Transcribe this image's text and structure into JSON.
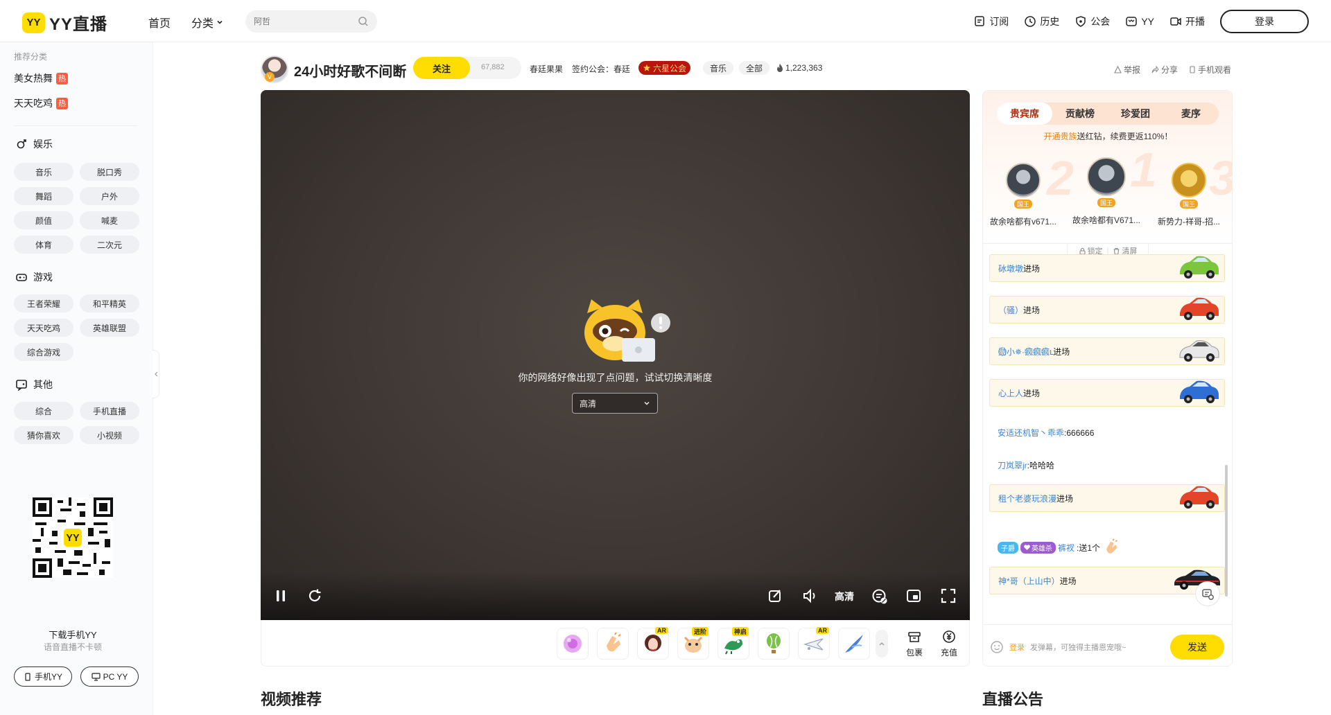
{
  "app": {
    "logo_badge": "YY",
    "logo_text": "YY直播"
  },
  "nav": {
    "home": "首页",
    "category": "分类"
  },
  "search": {
    "placeholder": "阿哲"
  },
  "topright": {
    "subscribe": "订阅",
    "history": "历史",
    "guild": "公会",
    "yy": "YY",
    "broadcast": "开播",
    "login": "登录"
  },
  "sidebar": {
    "rec_head": "推荐分类",
    "recommended": [
      {
        "label": "美女热舞",
        "badge": "热"
      },
      {
        "label": "天天吃鸡",
        "badge": "热"
      }
    ],
    "sections": [
      {
        "title": "娱乐",
        "icon": "female-icon",
        "items": [
          "音乐",
          "脱口秀",
          "舞蹈",
          "户外",
          "颜值",
          "喊麦",
          "体育",
          "二次元"
        ]
      },
      {
        "title": "游戏",
        "icon": "gamepad-icon",
        "items": [
          "王者荣耀",
          "和平精英",
          "天天吃鸡",
          "英雄联盟",
          "综合游戏"
        ]
      },
      {
        "title": "其他",
        "icon": "chat-icon",
        "items": [
          "综合",
          "手机直播",
          "猜你喜欢",
          "小视频"
        ]
      }
    ],
    "download_title": "下载手机YY",
    "download_sub": "语音直播不卡顿",
    "mobile_btn": "手机YY",
    "pc_btn": "PC YY"
  },
  "room": {
    "title": "24小时好歌不间断",
    "follow": "关注",
    "followers": "67,882",
    "anchor": "春廷果果",
    "signed_label": "签约公会：春廷",
    "guild_tag": "六星公会",
    "tag_music": "音乐",
    "tag_all": "全部",
    "heat": "1,223,363",
    "report": "举报",
    "share": "分享",
    "mobile_watch": "手机观看",
    "vip_badge": "V"
  },
  "player": {
    "error_text": "你的网络好像出现了点问题，试试切换清晰度",
    "quality_value": "高清",
    "quality_label": "高清"
  },
  "gifts": {
    "items": [
      {
        "name": "gift-flower",
        "badge": ""
      },
      {
        "name": "gift-clap",
        "badge": ""
      },
      {
        "name": "gift-ar-girl",
        "badge": "AR"
      },
      {
        "name": "gift-pet",
        "badge": "进阶"
      },
      {
        "name": "gift-dragon",
        "badge": "神启"
      },
      {
        "name": "gift-balloon",
        "badge": ""
      },
      {
        "name": "gift-ar-plane",
        "badge": "AR"
      },
      {
        "name": "gift-bird",
        "badge": ""
      }
    ],
    "bag": "包裹",
    "recharge": "充值"
  },
  "rpanel": {
    "tabs": [
      "贵宾席",
      "贡献榜",
      "珍爱团",
      "麦序"
    ],
    "promo_link": "开通贵族",
    "promo_text": "送红钻，续费更返110%！",
    "rank": [
      {
        "name": "故余啥都有v671...",
        "title": "国王",
        "num": "2"
      },
      {
        "name": "故余啥都有V671...",
        "title": "国王",
        "num": "1"
      },
      {
        "name": "新势力-祥哥-招...",
        "title": "国王",
        "num": "3"
      }
    ],
    "lock": "锁定",
    "clear": "清屏",
    "chat": [
      {
        "type": "entry",
        "user": "砅墩墩",
        "text": "进场",
        "car": "#7bc63c"
      },
      {
        "type": "entry",
        "user": "（骚）",
        "text": "进场",
        "car": "#e2452a"
      },
      {
        "type": "entry",
        "user": "勋⃝⃝小✵·疯⃝疯⃝疯⃝ւ",
        "text": "进场",
        "car": "#e8e8e8"
      },
      {
        "type": "entry",
        "user": "心上人",
        "text": "进场",
        "car": "#2f6fd4"
      },
      {
        "type": "msg",
        "user": "安适还机智丶乖乖",
        "text": ":666666"
      },
      {
        "type": "msg",
        "user": "刀岚翠jr",
        "text": ":哈哈哈"
      },
      {
        "type": "entry",
        "user": "租个老婆玩浪漫",
        "text": "进场",
        "car": "#e2452a"
      },
      {
        "type": "gift",
        "badge1": "子爵",
        "badge2": "英雄杀",
        "user": "裤衩",
        "text": ":送1个"
      },
      {
        "type": "entry",
        "user": "神*哥（上山中）",
        "text": "进场",
        "car": "#222"
      }
    ],
    "input_login": "登录",
    "input_placeholder": "发弹幕，可独得主播恩宠哦~",
    "send": "发送"
  },
  "sections": {
    "video_rec": "视频推荐",
    "notice": "直播公告"
  }
}
